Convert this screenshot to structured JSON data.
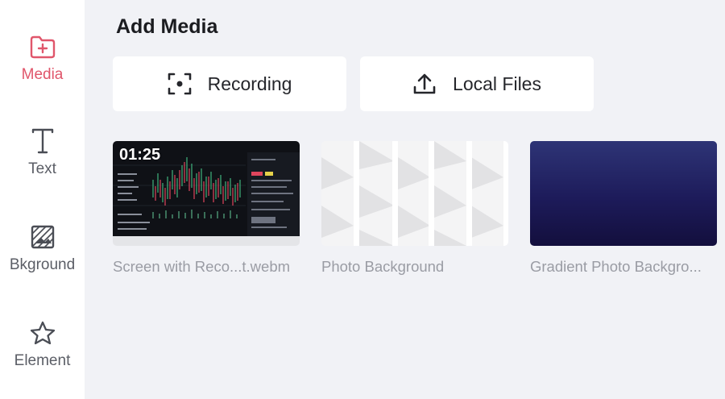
{
  "sidebar": {
    "items": [
      {
        "label": "Media",
        "icon": "folder-plus-icon",
        "active": true
      },
      {
        "label": "Text",
        "icon": "text-t-icon",
        "active": false
      },
      {
        "label": "Bkground",
        "icon": "background-pattern-icon",
        "active": false
      },
      {
        "label": "Element",
        "icon": "star-icon",
        "active": false
      }
    ]
  },
  "panel": {
    "title": "Add Media",
    "actions": [
      {
        "label": "Recording",
        "icon": "record-screen-icon"
      },
      {
        "label": "Local Files",
        "icon": "upload-icon"
      }
    ],
    "media": [
      {
        "name": "Screen with Reco...t.webm",
        "duration": "01:25",
        "kind": "screen-recording"
      },
      {
        "name": "Photo Background",
        "kind": "photo"
      },
      {
        "name": "Gradient Photo Backgro...",
        "kind": "gradient"
      }
    ]
  },
  "colors": {
    "accent": "#e0566b",
    "panel_bg": "#f1f2f6",
    "sidebar_bg": "#ffffff",
    "muted_text": "#9a9ca4"
  }
}
